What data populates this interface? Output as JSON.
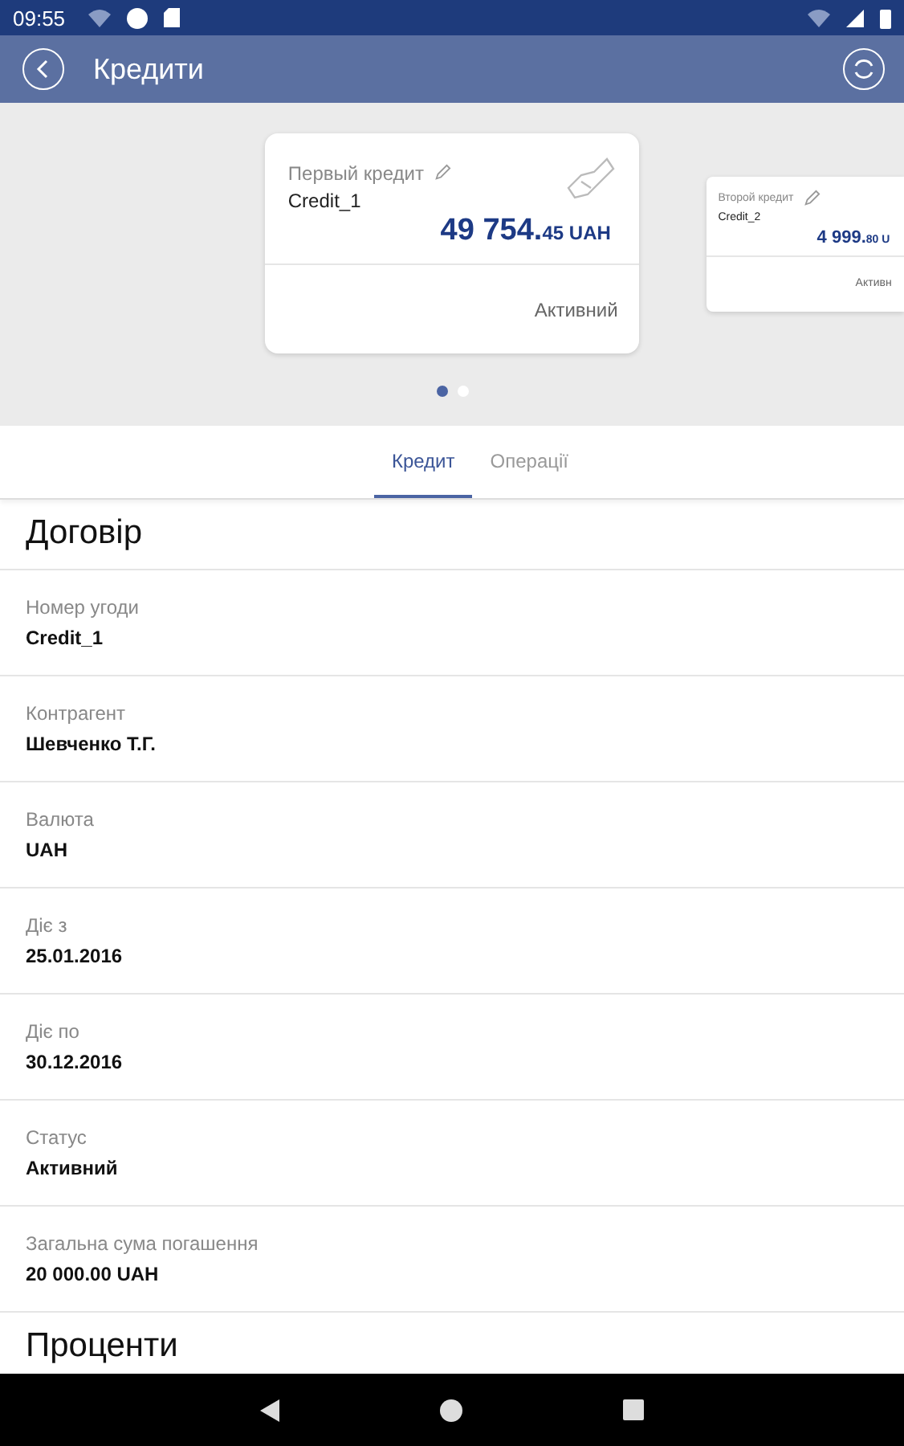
{
  "status_bar": {
    "time": "09:55"
  },
  "app_bar": {
    "title": "Кредити"
  },
  "cards": [
    {
      "name": "Первый кредит",
      "id": "Credit_1",
      "amount": "49 754.",
      "cents": "45",
      "currency": "UAH",
      "status": "Активний",
      "selected": true
    },
    {
      "name": "Второй кредит",
      "id": "Credit_2",
      "amount": "4 999.",
      "cents": "80",
      "currency": "U",
      "status": "Активн",
      "selected": false
    }
  ],
  "tabs": [
    {
      "label": "Кредит",
      "selected": true
    },
    {
      "label": "Операції",
      "selected": false
    }
  ],
  "sections": [
    {
      "title": "Договір",
      "fields": [
        {
          "label": "Номер угоди",
          "value": "Credit_1"
        },
        {
          "label": "Контрагент",
          "value": "Шевченко Т.Г."
        },
        {
          "label": "Валюта",
          "value": "UAH"
        },
        {
          "label": "Діє з",
          "value": "25.01.2016"
        },
        {
          "label": "Діє по",
          "value": "30.12.2016"
        },
        {
          "label": "Статус",
          "value": "Активний"
        },
        {
          "label": "Загальна сума погашення",
          "value": "20 000.00 UAH"
        }
      ]
    },
    {
      "title": "Проценти"
    }
  ]
}
